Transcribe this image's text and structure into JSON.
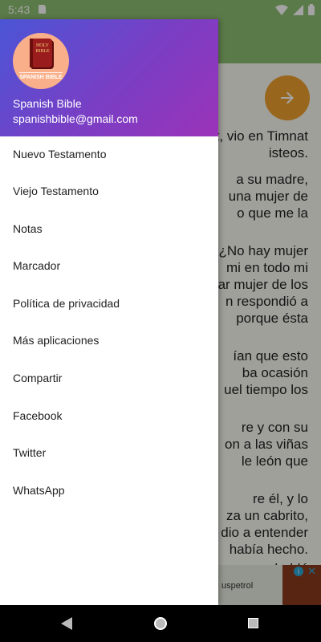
{
  "status_bar": {
    "time": "5:43"
  },
  "bible_text": {
    "lines": [
      "t, vio en Timnat",
      "isteos.",
      "a su madre,",
      "una mujer de",
      "o que me la",
      "¿No hay mujer",
      "mi en todo mi",
      "ar mujer de los",
      "n respondió a",
      "porque ésta",
      "ían que esto",
      "ba ocasión",
      "uel tiempo los",
      "re y con su",
      "on a las viñas",
      "le león que",
      "re él, y lo",
      "za un cabrito,",
      "dio a entender",
      "había hecho.",
      "a hablé"
    ]
  },
  "ad": {
    "text": "uspetrol"
  },
  "drawer": {
    "avatar": {
      "book_title": "HOLY BIBLE",
      "caption": "SPANISH BIBLE"
    },
    "user_name": "Spanish Bible",
    "user_email": "spanishbible@gmail.com",
    "menu": [
      {
        "label": "Nuevo Testamento"
      },
      {
        "label": "Viejo Testamento"
      },
      {
        "label": "Notas"
      },
      {
        "label": "Marcador"
      },
      {
        "label": "Política de privacidad"
      },
      {
        "label": "Más aplicaciones"
      },
      {
        "label": "Compartir"
      },
      {
        "label": "Facebook"
      },
      {
        "label": "Twitter"
      },
      {
        "label": "WhatsApp"
      }
    ]
  }
}
